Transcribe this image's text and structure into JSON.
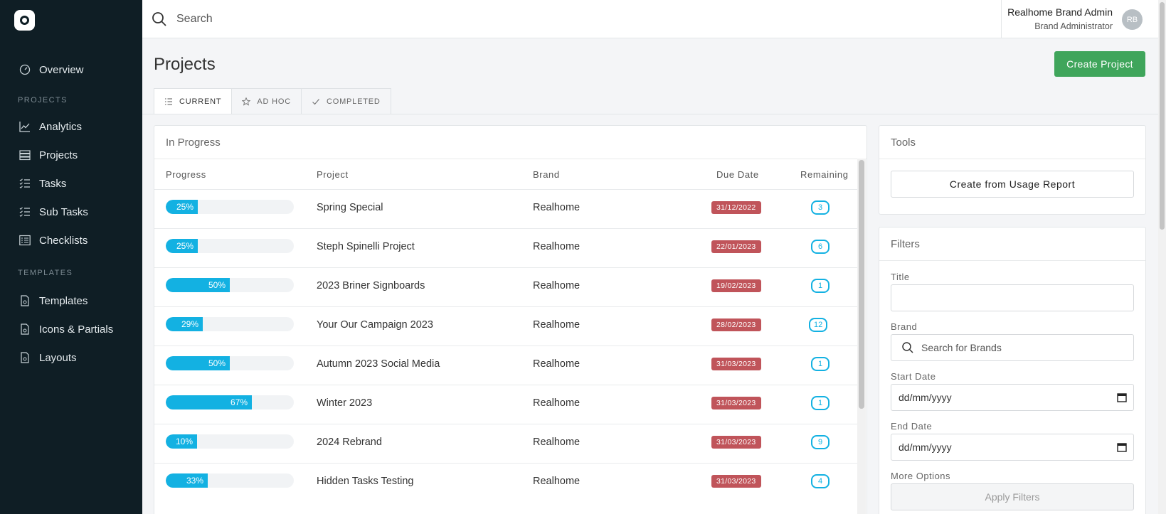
{
  "sidebar": {
    "overview_label": "Overview",
    "projects_section": "PROJECTS",
    "templates_section": "TEMPLATES",
    "items": [
      {
        "label": "Analytics"
      },
      {
        "label": "Projects"
      },
      {
        "label": "Tasks"
      },
      {
        "label": "Sub Tasks"
      },
      {
        "label": "Checklists"
      },
      {
        "label": "Templates"
      },
      {
        "label": "Icons & Partials"
      },
      {
        "label": "Layouts"
      }
    ]
  },
  "topbar": {
    "search_placeholder": "Search",
    "user_name": "Realhome Brand Admin",
    "user_role": "Brand Administrator",
    "avatar_initials": "RB"
  },
  "page": {
    "title": "Projects",
    "create_label": "Create Project",
    "tabs": [
      {
        "label": "CURRENT",
        "icon": "list-icon",
        "active": true
      },
      {
        "label": "AD HOC",
        "icon": "star-icon",
        "active": false
      },
      {
        "label": "COMPLETED",
        "icon": "check-icon",
        "active": false
      }
    ]
  },
  "in_progress": {
    "title": "In Progress",
    "columns": {
      "progress": "Progress",
      "project": "Project",
      "brand": "Brand",
      "due": "Due Date",
      "remaining": "Remaining"
    },
    "rows": [
      {
        "progress": "25%",
        "project": "Spring Special",
        "brand": "Realhome",
        "due": "31/12/2022",
        "remaining": "3"
      },
      {
        "progress": "25%",
        "project": "Steph Spinelli Project",
        "brand": "Realhome",
        "due": "22/01/2023",
        "remaining": "6"
      },
      {
        "progress": "50%",
        "project": "2023 Briner Signboards",
        "brand": "Realhome",
        "due": "19/02/2023",
        "remaining": "1"
      },
      {
        "progress": "29%",
        "project": "Your Our Campaign 2023",
        "brand": "Realhome",
        "due": "28/02/2023",
        "remaining": "12"
      },
      {
        "progress": "50%",
        "project": "Autumn 2023 Social Media",
        "brand": "Realhome",
        "due": "31/03/2023",
        "remaining": "1"
      },
      {
        "progress": "67%",
        "project": "Winter 2023",
        "brand": "Realhome",
        "due": "31/03/2023",
        "remaining": "1"
      },
      {
        "progress": "10%",
        "project": "2024 Rebrand",
        "brand": "Realhome",
        "due": "31/03/2023",
        "remaining": "9"
      },
      {
        "progress": "33%",
        "project": "Hidden Tasks Testing",
        "brand": "Realhome",
        "due": "31/03/2023",
        "remaining": "4"
      }
    ]
  },
  "tools": {
    "title": "Tools",
    "usage_button": "Create from Usage Report"
  },
  "filters": {
    "title": "Filters",
    "title_label": "Title",
    "brand_label": "Brand",
    "brand_placeholder": "Search for Brands",
    "start_label": "Start Date",
    "start_value": "dd/mm/yyyy",
    "end_label": "End Date",
    "end_value": "dd/mm/yyyy",
    "more_label": "More Options",
    "apply_label": "Apply Filters"
  },
  "colors": {
    "sidebar_bg": "#0f1e25",
    "accent_blue": "#13b1e2",
    "due_red": "#c0545a",
    "create_green": "#3fa55b"
  }
}
